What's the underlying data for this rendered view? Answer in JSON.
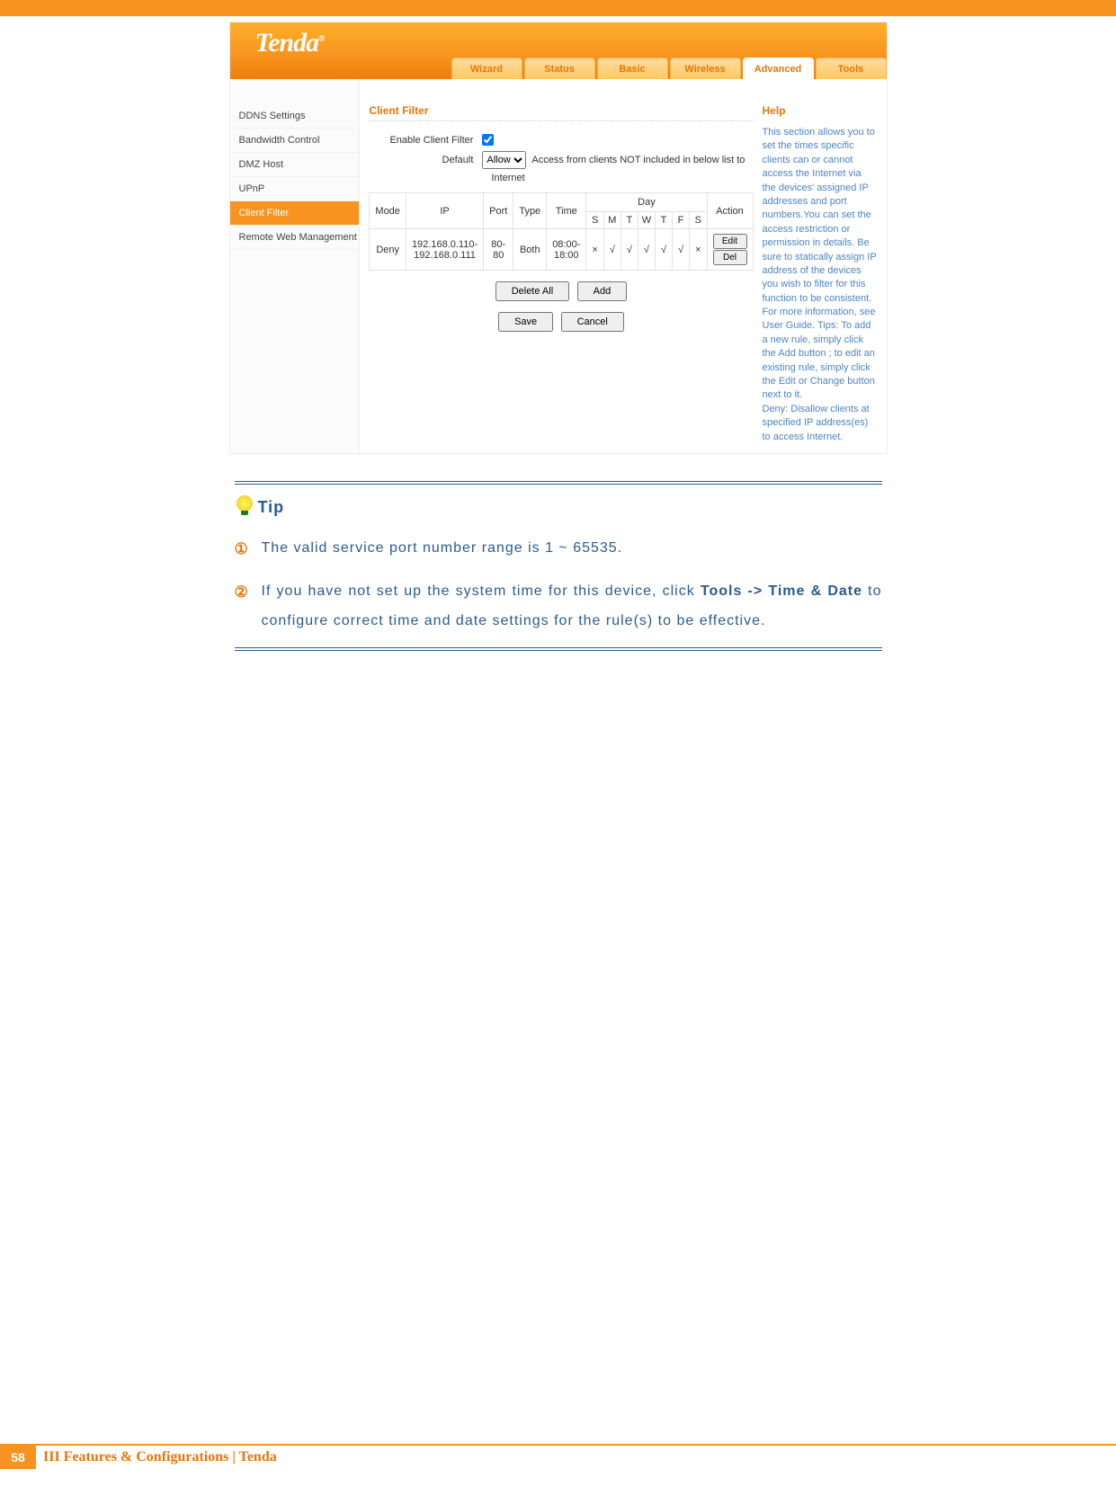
{
  "logo_text": "Tenda",
  "nav": {
    "tabs": [
      "Wizard",
      "Status",
      "Basic",
      "Wireless",
      "Advanced",
      "Tools"
    ],
    "active": 4
  },
  "sidebar": {
    "items": [
      "DDNS Settings",
      "Bandwidth Control",
      "DMZ Host",
      "UPnP",
      "Client Filter",
      "Remote Web Management"
    ],
    "active": 4
  },
  "panel": {
    "title": "Client Filter",
    "enable_label": "Enable Client Filter",
    "enable_checked": true,
    "default_label": "Default",
    "default_select": "Allow",
    "default_note": "Access from clients NOT included in below list to",
    "internet_label": "Internet"
  },
  "table": {
    "head_mode": "Mode",
    "head_ip": "IP",
    "head_port": "Port",
    "head_type": "Type",
    "head_time": "Time",
    "head_day": "Day",
    "day_cols": [
      "S",
      "M",
      "T",
      "W",
      "T",
      "F",
      "S"
    ],
    "head_action": "Action",
    "row": {
      "mode": "Deny",
      "ip": "192.168.0.110-192.168.0.111",
      "port": "80-80",
      "type": "Both",
      "time": "08:00-18:00",
      "days": [
        "×",
        "√",
        "√",
        "√",
        "√",
        "√",
        "×"
      ],
      "edit": "Edit",
      "del": "Del"
    }
  },
  "buttons": {
    "delete_all": "Delete All",
    "add": "Add",
    "save": "Save",
    "cancel": "Cancel"
  },
  "help": {
    "title": "Help",
    "text": "This section allows you to set the times specific clients can or cannot access the Internet via the devices' assigned IP addresses and port numbers.You can set the access restriction or permission in details. Be sure to statically assign IP address of the devices you wish to filter for this function to be consistent. For more information, see User Guide. Tips: To add a new rule, simply click the Add button ; to edit an existing rule, simply click the Edit or Change button next to it.\nDeny: Disallow clients at specified IP address(es) to access Internet."
  },
  "tip": {
    "heading": "Tip",
    "items": [
      {
        "num": "①",
        "html": "The valid service port number range is 1 ~ 65535."
      },
      {
        "num": "②",
        "html": "If you have not set up the system time for this device, click <b>Tools -> Time & Date</b> to configure correct time and date settings for the rule(s) to be effective."
      }
    ]
  },
  "footer": {
    "page": "58",
    "text": "III Features & Configurations | Tenda"
  }
}
